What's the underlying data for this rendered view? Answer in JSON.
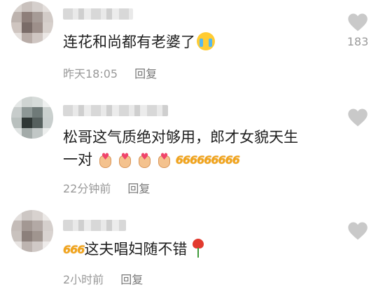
{
  "comments": [
    {
      "text": "连花和尚都有老婆了",
      "emoji": "loudly-crying-face",
      "time": "昨天18:05",
      "reply_label": "回复",
      "like_count": "183"
    },
    {
      "text_line1": "松哥这气质绝对够用，郎才女貌天生",
      "text_line2": "一对",
      "emoji": "finger-heart-hand x4",
      "sixes": "666666666",
      "time": "22分钟前",
      "reply_label": "回复"
    },
    {
      "sixes": "666",
      "text": "这夫唱妇随不错",
      "emoji": "rose",
      "time": "2小时前",
      "reply_label": "回复"
    }
  ],
  "colors": {
    "text": "#1e1e1e",
    "meta": "#999999",
    "heart": "#c9c9c9",
    "sixes": "#f2a51c"
  }
}
